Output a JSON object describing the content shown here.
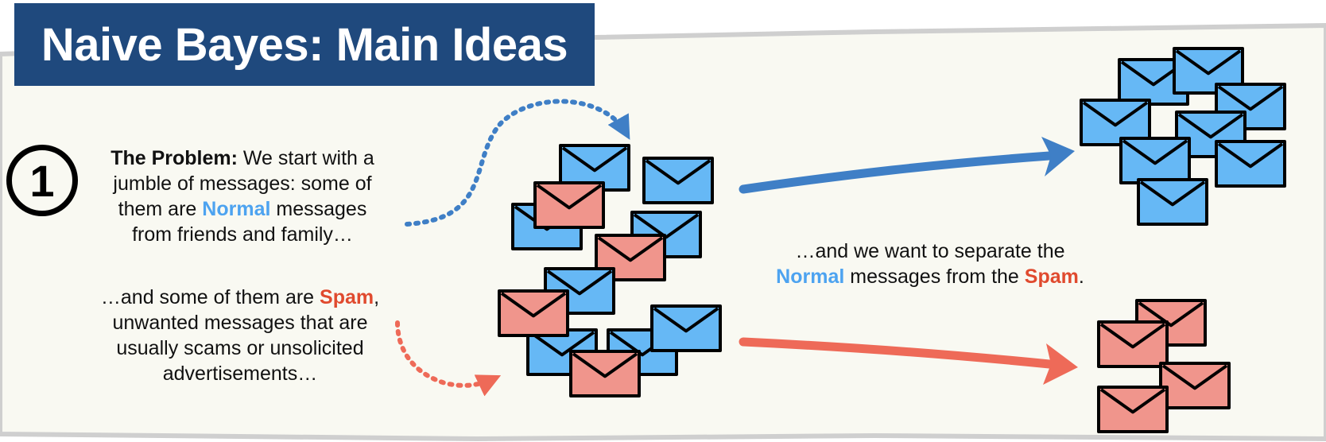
{
  "title": "Naive Bayes: Main Ideas",
  "step": {
    "number": "1",
    "heading": "The Problem:",
    "line1": "We start with a",
    "line2": "jumble of messages: some of",
    "line3_before": "them are",
    "line3_highlight": "Normal",
    "line3_after": "messages",
    "line4": "from friends and family…"
  },
  "spam_note": {
    "line1_before": "…and some of them are",
    "line1_highlight": "Spam",
    "line1_after": ",",
    "line2": "unwanted messages that are",
    "line3": "usually scams or unsolicited",
    "line4": "advertisements…"
  },
  "goal": {
    "line1": "…and we want to separate the",
    "line2_highlight1": "Normal",
    "line2_middle": "messages from the",
    "line2_highlight2": "Spam",
    "line2_end": "."
  },
  "colors": {
    "normal": "#66b8f5",
    "spam": "#f0958c",
    "title_bg": "#1f497d",
    "blue_arrow": "#3f7fc6",
    "red_arrow": "#ee6a58",
    "panel_bg": "#f9f9f2"
  }
}
